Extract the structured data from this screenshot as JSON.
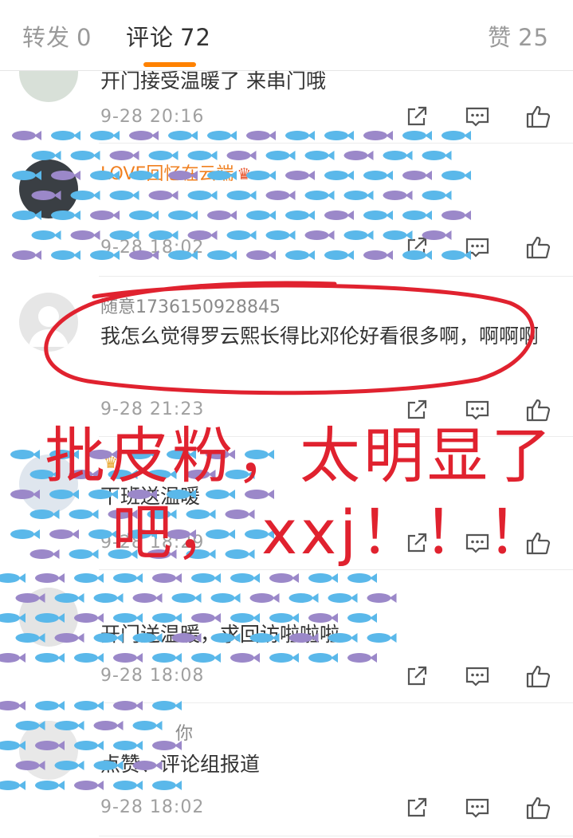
{
  "tabs": {
    "repost": {
      "label": "转发",
      "count": "0"
    },
    "comments": {
      "label": "评论",
      "count": "72"
    },
    "likes": {
      "label": "赞",
      "count": "25"
    }
  },
  "colors": {
    "accent": "#ff8200",
    "annotation_red": "#e0222f",
    "fish_blue": "#5ab8ea",
    "fish_purple": "#9b88c9"
  },
  "comments": [
    {
      "username": "",
      "text": "开门接受温暖了 来串门哦",
      "time": "9-28 20:16"
    },
    {
      "username": "LOVE回忆在云端",
      "text": "",
      "time": "9-28 18:02"
    },
    {
      "username": "随意1736150928845",
      "text": "我怎么觉得罗云熙长得比邓伦好看很多啊，啊啊啊",
      "time": "9-28 21:23"
    },
    {
      "username": "",
      "text": "下班送温暖",
      "time": "9-28 18:29"
    },
    {
      "username": "",
      "text": "开门送温暖，求回访啦啦啦",
      "time": "9-28 18:08"
    },
    {
      "username": "你",
      "text": "点赞、评论组报道",
      "time": "9-28 18:02"
    }
  ],
  "icons": {
    "share": "share-icon",
    "reply": "comment-icon",
    "like": "thumbs-up-icon"
  },
  "annotation": {
    "line1": "批皮粉，太明显了",
    "line2": "吧， xxj！！！"
  }
}
